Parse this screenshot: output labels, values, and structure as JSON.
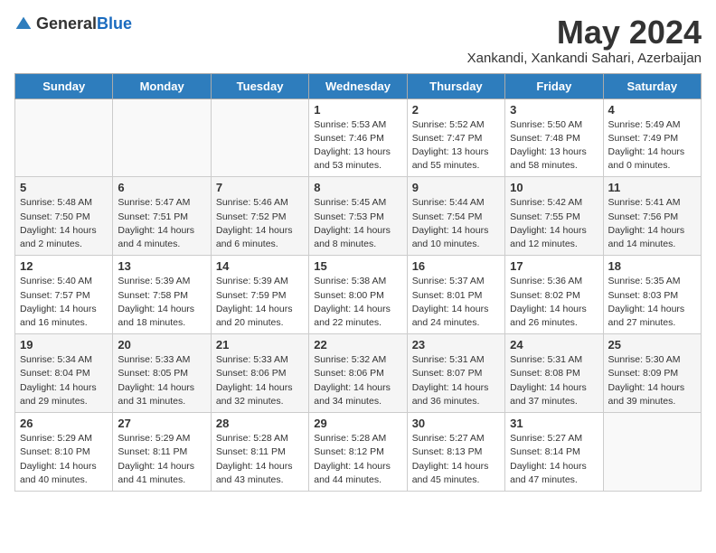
{
  "header": {
    "logo_general": "General",
    "logo_blue": "Blue",
    "month_year": "May 2024",
    "location": "Xankandi, Xankandi Sahari, Azerbaijan"
  },
  "days_of_week": [
    "Sunday",
    "Monday",
    "Tuesday",
    "Wednesday",
    "Thursday",
    "Friday",
    "Saturday"
  ],
  "weeks": [
    [
      {
        "day": "",
        "info": ""
      },
      {
        "day": "",
        "info": ""
      },
      {
        "day": "",
        "info": ""
      },
      {
        "day": "1",
        "info": "Sunrise: 5:53 AM\nSunset: 7:46 PM\nDaylight: 13 hours\nand 53 minutes."
      },
      {
        "day": "2",
        "info": "Sunrise: 5:52 AM\nSunset: 7:47 PM\nDaylight: 13 hours\nand 55 minutes."
      },
      {
        "day": "3",
        "info": "Sunrise: 5:50 AM\nSunset: 7:48 PM\nDaylight: 13 hours\nand 58 minutes."
      },
      {
        "day": "4",
        "info": "Sunrise: 5:49 AM\nSunset: 7:49 PM\nDaylight: 14 hours\nand 0 minutes."
      }
    ],
    [
      {
        "day": "5",
        "info": "Sunrise: 5:48 AM\nSunset: 7:50 PM\nDaylight: 14 hours\nand 2 minutes."
      },
      {
        "day": "6",
        "info": "Sunrise: 5:47 AM\nSunset: 7:51 PM\nDaylight: 14 hours\nand 4 minutes."
      },
      {
        "day": "7",
        "info": "Sunrise: 5:46 AM\nSunset: 7:52 PM\nDaylight: 14 hours\nand 6 minutes."
      },
      {
        "day": "8",
        "info": "Sunrise: 5:45 AM\nSunset: 7:53 PM\nDaylight: 14 hours\nand 8 minutes."
      },
      {
        "day": "9",
        "info": "Sunrise: 5:44 AM\nSunset: 7:54 PM\nDaylight: 14 hours\nand 10 minutes."
      },
      {
        "day": "10",
        "info": "Sunrise: 5:42 AM\nSunset: 7:55 PM\nDaylight: 14 hours\nand 12 minutes."
      },
      {
        "day": "11",
        "info": "Sunrise: 5:41 AM\nSunset: 7:56 PM\nDaylight: 14 hours\nand 14 minutes."
      }
    ],
    [
      {
        "day": "12",
        "info": "Sunrise: 5:40 AM\nSunset: 7:57 PM\nDaylight: 14 hours\nand 16 minutes."
      },
      {
        "day": "13",
        "info": "Sunrise: 5:39 AM\nSunset: 7:58 PM\nDaylight: 14 hours\nand 18 minutes."
      },
      {
        "day": "14",
        "info": "Sunrise: 5:39 AM\nSunset: 7:59 PM\nDaylight: 14 hours\nand 20 minutes."
      },
      {
        "day": "15",
        "info": "Sunrise: 5:38 AM\nSunset: 8:00 PM\nDaylight: 14 hours\nand 22 minutes."
      },
      {
        "day": "16",
        "info": "Sunrise: 5:37 AM\nSunset: 8:01 PM\nDaylight: 14 hours\nand 24 minutes."
      },
      {
        "day": "17",
        "info": "Sunrise: 5:36 AM\nSunset: 8:02 PM\nDaylight: 14 hours\nand 26 minutes."
      },
      {
        "day": "18",
        "info": "Sunrise: 5:35 AM\nSunset: 8:03 PM\nDaylight: 14 hours\nand 27 minutes."
      }
    ],
    [
      {
        "day": "19",
        "info": "Sunrise: 5:34 AM\nSunset: 8:04 PM\nDaylight: 14 hours\nand 29 minutes."
      },
      {
        "day": "20",
        "info": "Sunrise: 5:33 AM\nSunset: 8:05 PM\nDaylight: 14 hours\nand 31 minutes."
      },
      {
        "day": "21",
        "info": "Sunrise: 5:33 AM\nSunset: 8:06 PM\nDaylight: 14 hours\nand 32 minutes."
      },
      {
        "day": "22",
        "info": "Sunrise: 5:32 AM\nSunset: 8:06 PM\nDaylight: 14 hours\nand 34 minutes."
      },
      {
        "day": "23",
        "info": "Sunrise: 5:31 AM\nSunset: 8:07 PM\nDaylight: 14 hours\nand 36 minutes."
      },
      {
        "day": "24",
        "info": "Sunrise: 5:31 AM\nSunset: 8:08 PM\nDaylight: 14 hours\nand 37 minutes."
      },
      {
        "day": "25",
        "info": "Sunrise: 5:30 AM\nSunset: 8:09 PM\nDaylight: 14 hours\nand 39 minutes."
      }
    ],
    [
      {
        "day": "26",
        "info": "Sunrise: 5:29 AM\nSunset: 8:10 PM\nDaylight: 14 hours\nand 40 minutes."
      },
      {
        "day": "27",
        "info": "Sunrise: 5:29 AM\nSunset: 8:11 PM\nDaylight: 14 hours\nand 41 minutes."
      },
      {
        "day": "28",
        "info": "Sunrise: 5:28 AM\nSunset: 8:11 PM\nDaylight: 14 hours\nand 43 minutes."
      },
      {
        "day": "29",
        "info": "Sunrise: 5:28 AM\nSunset: 8:12 PM\nDaylight: 14 hours\nand 44 minutes."
      },
      {
        "day": "30",
        "info": "Sunrise: 5:27 AM\nSunset: 8:13 PM\nDaylight: 14 hours\nand 45 minutes."
      },
      {
        "day": "31",
        "info": "Sunrise: 5:27 AM\nSunset: 8:14 PM\nDaylight: 14 hours\nand 47 minutes."
      },
      {
        "day": "",
        "info": ""
      }
    ]
  ]
}
